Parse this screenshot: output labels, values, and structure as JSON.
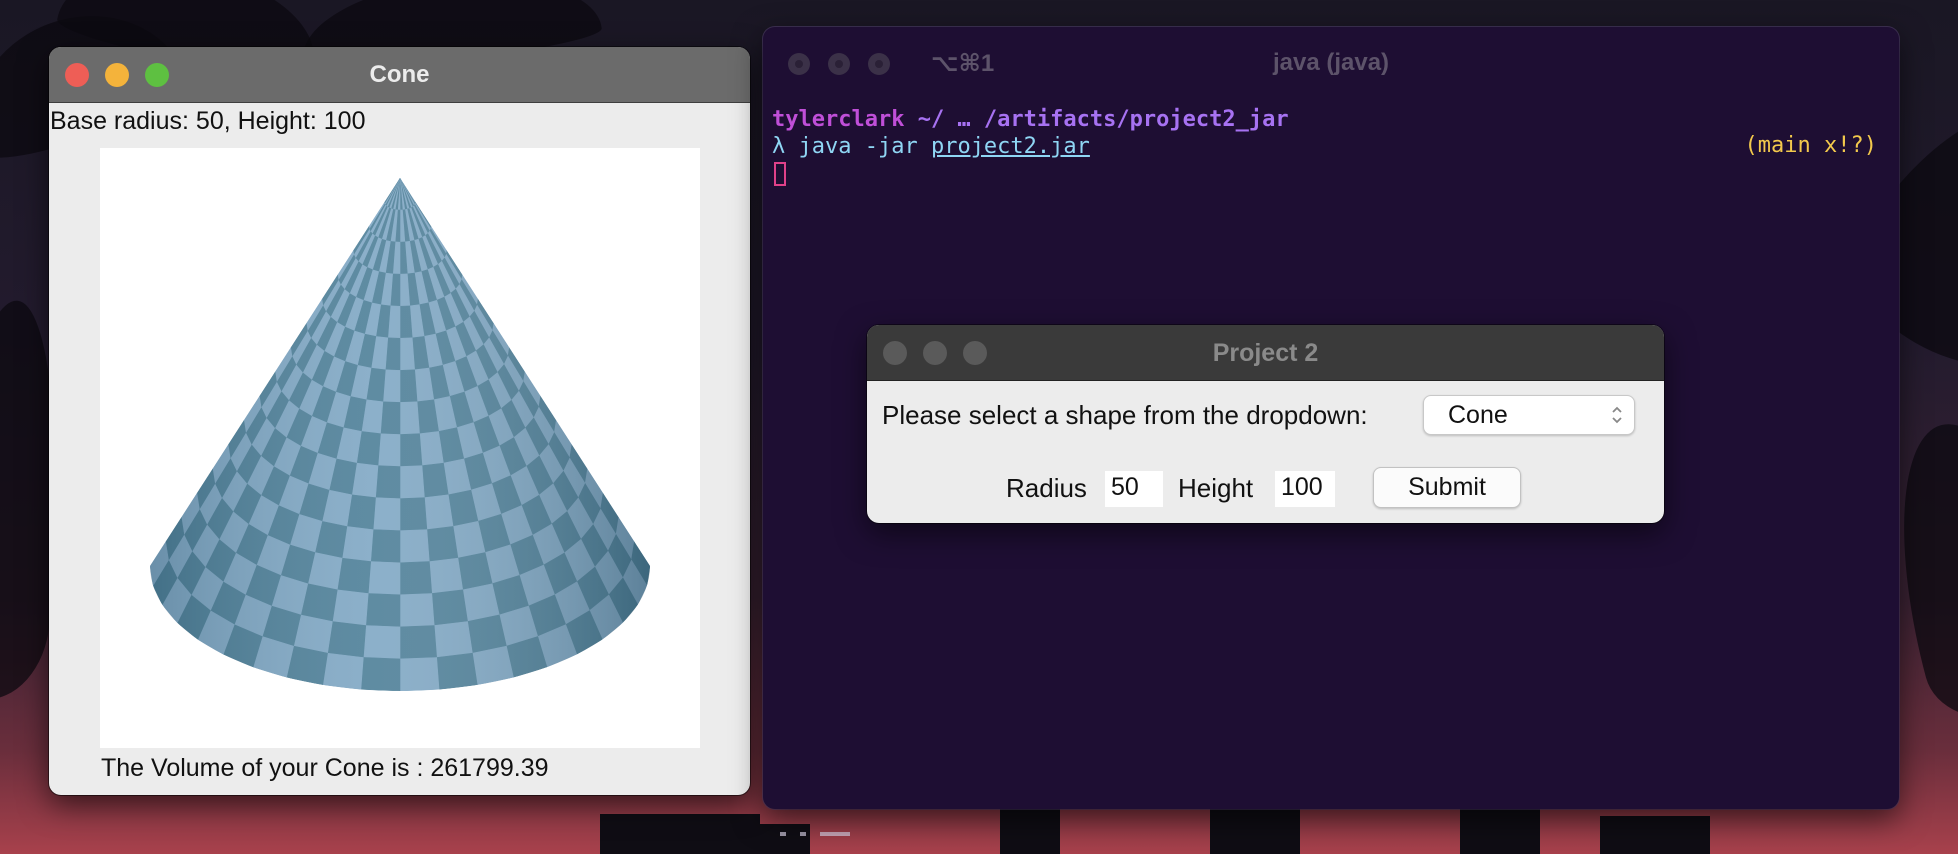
{
  "cone_window": {
    "title": "Cone",
    "info": "Base radius: 50, Height: 100",
    "volume_text": "The Volume of your Cone is : 261799.39"
  },
  "terminal": {
    "shortcut": "⌥⌘1",
    "title": "java (java)",
    "user": "tylerclark",
    "path": " ~/ … /artifacts/project2_jar",
    "prompt_symbol": "λ",
    "command": " java -jar ",
    "command_file": "project2.jar",
    "git_status": "(main x!?)"
  },
  "dialog": {
    "title": "Project 2",
    "prompt": "Please select a shape from the dropdown:",
    "shape_selected": "Cone",
    "radius_label": "Radius",
    "radius_value": "50",
    "height_label": "Height",
    "height_value": "100",
    "submit_label": "Submit"
  },
  "colors": {
    "cone_light": "#7fa7c4",
    "cone_dark": "#4d7f98",
    "terminal_bg": "#1e0e33",
    "terminal_user": "#c04fd8",
    "terminal_path": "#a772f2",
    "terminal_cmd": "#8fd6f4",
    "terminal_git": "#f3c94c"
  }
}
